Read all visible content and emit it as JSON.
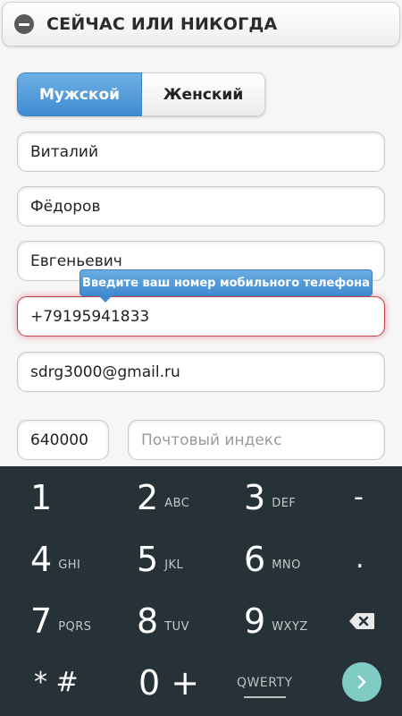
{
  "header": {
    "title": "СЕЙЧАС ИЛИ НИКОГДА",
    "icon": "minus-circle-icon"
  },
  "gender": {
    "male": "Мужской",
    "female": "Женский",
    "selected": "male"
  },
  "form": {
    "first_name": "Виталий",
    "last_name": "Фёдоров",
    "middle_name": "Евгеньевич",
    "phone": "+79195941833",
    "phone_tooltip": "Введите ваш номер мобильного телефона",
    "email": "sdrg3000@gmail.ru",
    "postal_code": "640000",
    "postal_placeholder": "Почтовый индекс"
  },
  "keyboard": {
    "rows": [
      [
        {
          "digit": "1",
          "letters": ""
        },
        {
          "digit": "2",
          "letters": "ABC"
        },
        {
          "digit": "3",
          "letters": "DEF"
        },
        {
          "symbol": "-"
        }
      ],
      [
        {
          "digit": "4",
          "letters": "GHI"
        },
        {
          "digit": "5",
          "letters": "JKL"
        },
        {
          "digit": "6",
          "letters": "MNO"
        },
        {
          "symbol": "."
        }
      ],
      [
        {
          "digit": "7",
          "letters": "PQRS"
        },
        {
          "digit": "8",
          "letters": "TUV"
        },
        {
          "digit": "9",
          "letters": "WXYZ"
        },
        {
          "icon": "backspace-icon"
        }
      ],
      [
        {
          "symbol": "* #"
        },
        {
          "symbol": "0 +"
        },
        {
          "label": "QWERTY"
        },
        {
          "icon": "next-arrow-icon"
        }
      ]
    ],
    "colors": {
      "background": "#263238",
      "next_button": "#80cbc4"
    }
  }
}
